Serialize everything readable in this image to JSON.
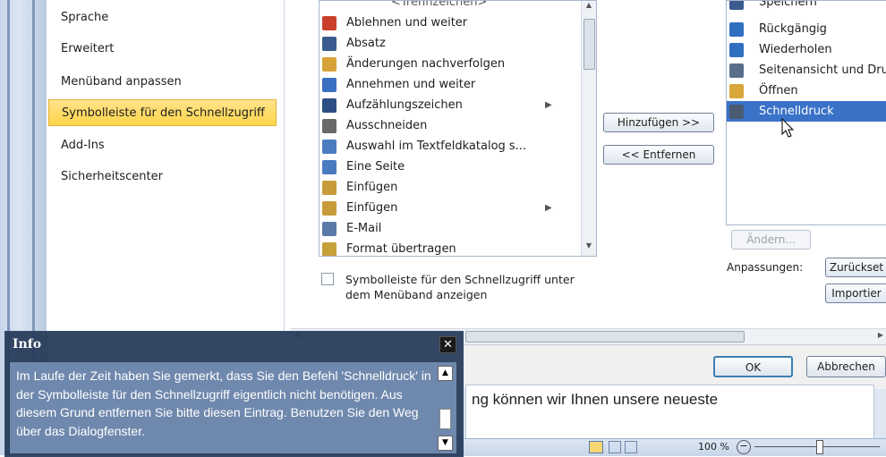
{
  "nav": {
    "items": [
      {
        "label": "Sprache"
      },
      {
        "label": "Erweitert"
      },
      {
        "label": "Menüband anpassen"
      },
      {
        "label": "Symbolleiste für den Schnellzugriff",
        "selected": true
      },
      {
        "label": "Add-Ins"
      },
      {
        "label": "Sicherheitscenter"
      }
    ]
  },
  "commands": {
    "partial_top": "<Trennzeichen>",
    "items": [
      {
        "label": "Ablehnen und weiter",
        "icon": "reject-icon",
        "color": "#c8402a"
      },
      {
        "label": "Absatz",
        "icon": "paragraph-icon",
        "color": "#3b5b8f"
      },
      {
        "label": "Änderungen nachverfolgen",
        "icon": "track-changes-icon",
        "color": "#d8a23a"
      },
      {
        "label": "Annehmen und weiter",
        "icon": "accept-icon",
        "color": "#3a6fc2"
      },
      {
        "label": "Aufzählungszeichen",
        "icon": "bullets-icon",
        "color": "#2c4f85",
        "submenu": "▶"
      },
      {
        "label": "Ausschneiden",
        "icon": "cut-icon",
        "color": "#6a6a6a"
      },
      {
        "label": "Auswahl im Textfeldkatalog s...",
        "icon": "textbox-icon",
        "color": "#4b7cc0"
      },
      {
        "label": "Eine Seite",
        "icon": "one-page-icon",
        "color": "#4a7ac0"
      },
      {
        "label": "Einfügen",
        "icon": "paste-icon",
        "color": "#c89b3a"
      },
      {
        "label": "Einfügen",
        "icon": "paste-icon",
        "color": "#c89b3a",
        "submenu": "▶"
      },
      {
        "label": "E-Mail",
        "icon": "email-icon",
        "color": "#5a7aa8"
      },
      {
        "label": "Format übertragen",
        "icon": "format-painter-icon",
        "color": "#c8a03a"
      }
    ]
  },
  "buttons": {
    "add": "Hinzufügen >>",
    "remove": "<< Entfernen",
    "modify": "Ändern...",
    "reset": "Zurückset",
    "import": "Importier",
    "ok": "OK",
    "cancel": "Abbrechen"
  },
  "qat": {
    "partial_top": "Speichern",
    "items": [
      {
        "label": "Rückgängig",
        "icon": "undo-icon",
        "color": "#2f6fc0"
      },
      {
        "label": "Wiederholen",
        "icon": "redo-icon",
        "color": "#2f6fc0"
      },
      {
        "label": "Seitenansicht und Dru",
        "icon": "print-preview-icon",
        "color": "#5a6e8c"
      },
      {
        "label": "Öffnen",
        "icon": "open-folder-icon",
        "color": "#d9a73a"
      },
      {
        "label": "Schnelldruck",
        "icon": "quick-print-icon",
        "color": "#4a5a70",
        "selected": true
      }
    ]
  },
  "options": {
    "checkbox_label_line1": "Symbolleiste für den Schnellzugriff unter",
    "checkbox_label_line2": "dem Menüband anzeigen",
    "customizations_label": "Anpassungen:"
  },
  "doc": {
    "text": "ng können wir Ihnen unsere neueste",
    "zoom": "100 %"
  },
  "info": {
    "title": "Info",
    "close": "✕",
    "text": "Im Laufe der Zeit haben Sie gemerkt, dass Sie den Befehl 'Schnelldruck' in der Symbolleiste für den Schnellzugriff eigentlich nicht benötigen. Aus diesem Grund entfernen Sie bitte diesen Eintrag. Benutzen Sie den Weg über das Dialogfenster."
  }
}
